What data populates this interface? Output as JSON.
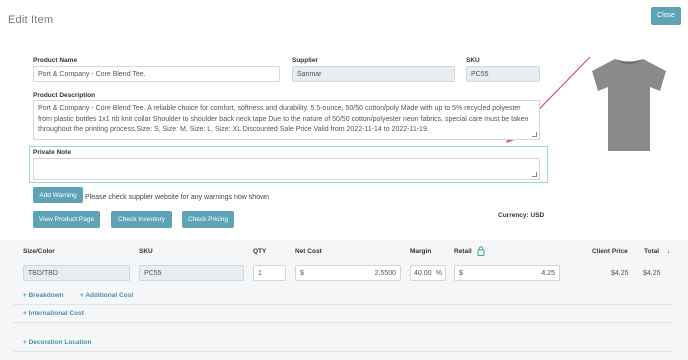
{
  "header": {
    "title": "Edit Item",
    "close_label": "Close"
  },
  "form": {
    "product_name": {
      "label": "Product Name",
      "value": "Port & Company - Core Blend Tee."
    },
    "supplier": {
      "label": "Supplier",
      "value": "Sanmar"
    },
    "sku": {
      "label": "SKU",
      "value": "PC55"
    },
    "description": {
      "label": "Product Description",
      "value": "Port & Company - Core Blend Tee. A reliable choice for comfort, softness and durability. 5.5-ounce, 50/50 cotton/poly Made with up to 5% recycled polyester from plastic bottles 1x1 rib knit collar Shoulder to shoulder back neck tape Due to the nature of 50/50 cotton/polyester neon fabrics, special care must be taken throughout the printing process.Size: S, Size: M, Size: L, Size: XL Discounted Sale Price Valid from 2022-11-14 to 2022-11-19."
    },
    "private_note": {
      "label": "Private Note",
      "value": ""
    }
  },
  "warnings": {
    "button": "Add Warning",
    "message": "Please check supplier website for any warnings now shown"
  },
  "actions": {
    "view_product": "View Product Page",
    "check_inventory": "Check Inventory",
    "check_pricing": "Check Pricing"
  },
  "currency": "Currency: USD",
  "table": {
    "headers": {
      "size_color": "Size/Color",
      "sku": "SKU",
      "qty": "QTY",
      "net_cost": "Net Cost",
      "margin": "Margin",
      "retail": "Retail",
      "client_price": "Client Price",
      "total": "Total"
    },
    "row": {
      "size_color": "TBD/TBD",
      "sku": "PC55",
      "qty": "1",
      "net_cost_prefix": "$",
      "net_cost": "2.5500",
      "margin": "40.00",
      "margin_suffix": "%",
      "retail_prefix": "$",
      "retail": "4.25",
      "client_price": "$4.25",
      "total": "$4.25"
    },
    "sort_icon": "↓"
  },
  "links": {
    "breakdown": "+ Breakdown",
    "additional_cost": "+ Additional Cost",
    "international_cost": "+ International Cost",
    "decoration_location": "+ Decoration Location"
  },
  "colors": {
    "accent": "#5fa3b7",
    "link": "#4b8fae",
    "annotation_arrow": "#e0409a"
  }
}
